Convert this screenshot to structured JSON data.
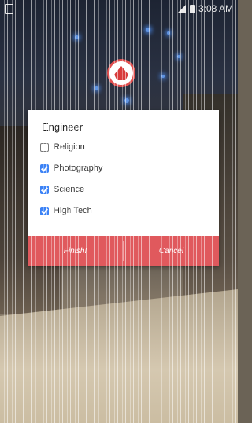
{
  "status_bar": {
    "time": "3:08 AM"
  },
  "profile": {
    "name": ""
  },
  "dialog": {
    "title": "Engineer",
    "options": [
      {
        "label": "Religion",
        "checked": false
      },
      {
        "label": "Photography",
        "checked": true
      },
      {
        "label": "Science",
        "checked": true
      },
      {
        "label": "High Tech",
        "checked": true
      }
    ],
    "finish_label": "Finish!",
    "cancel_label": "Cancel"
  },
  "colors": {
    "dialog_button_bg": "#e0595d",
    "checkbox_checked": "#3b82f6"
  }
}
